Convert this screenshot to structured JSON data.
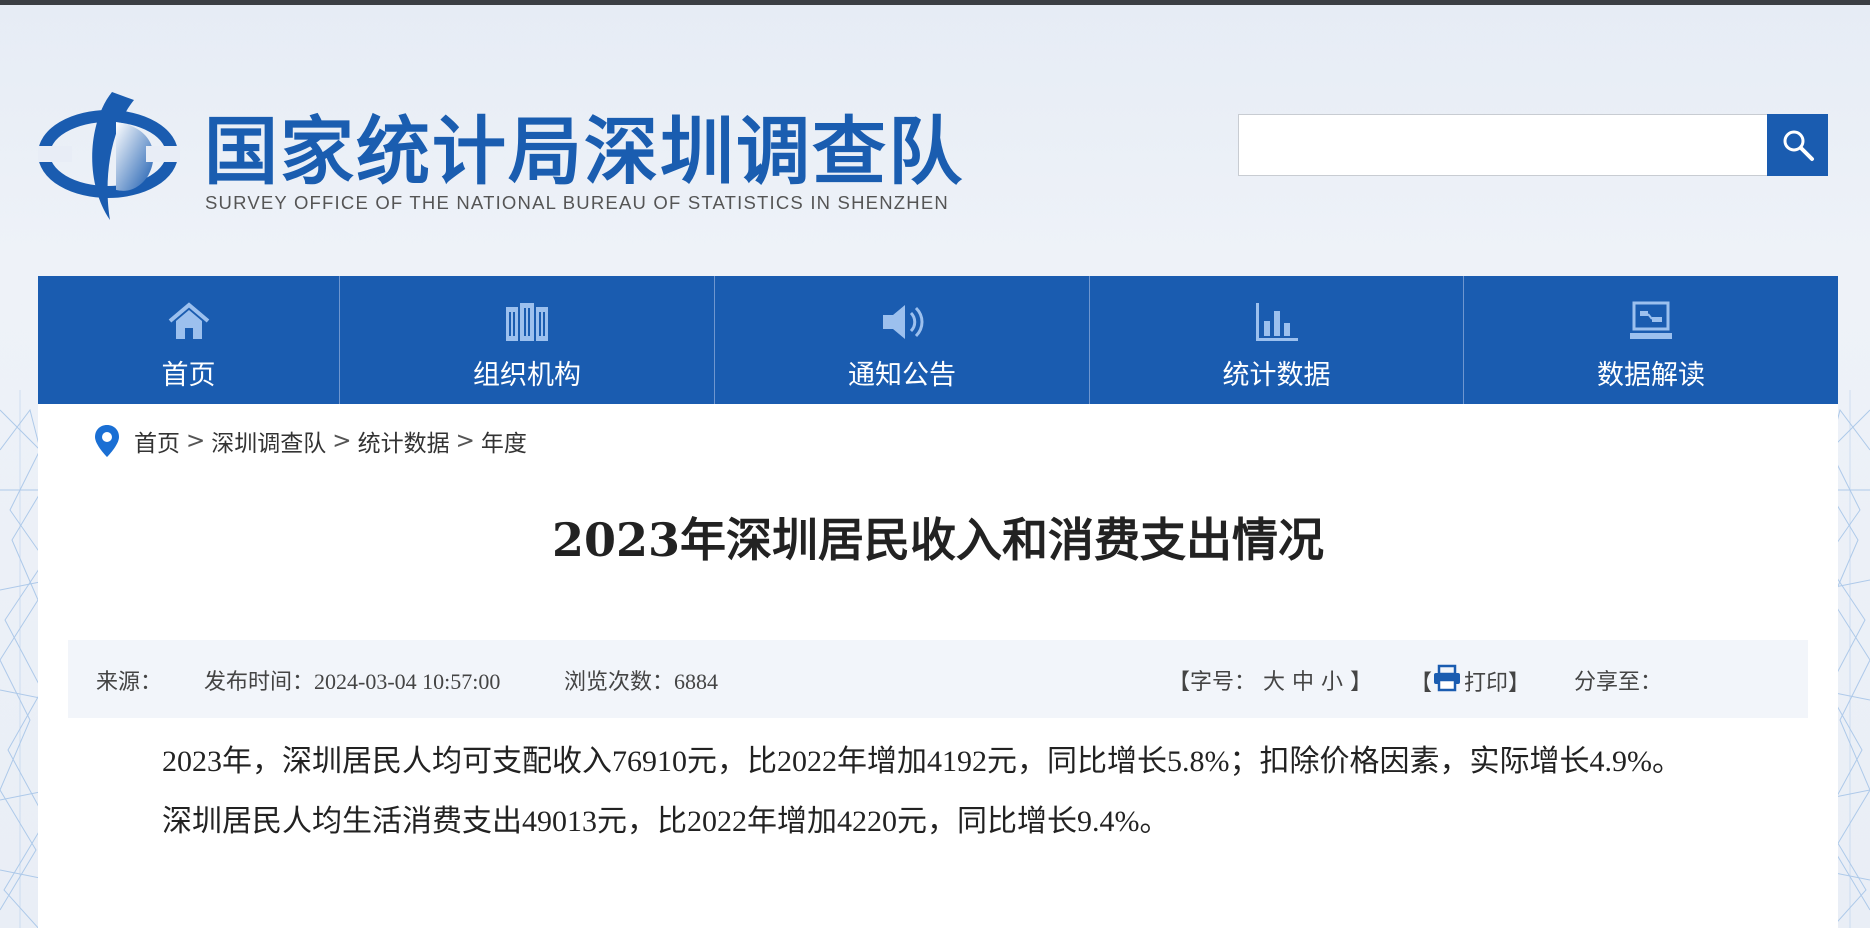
{
  "header": {
    "title": "国家统计局深圳调查队",
    "subtitle": "SURVEY OFFICE OF THE NATIONAL BUREAU OF STATISTICS IN SHENZHEN"
  },
  "search": {
    "value": "",
    "placeholder": ""
  },
  "nav": {
    "items": [
      {
        "label": "首页",
        "icon": "home-icon"
      },
      {
        "label": "组织机构",
        "icon": "building-icon"
      },
      {
        "label": "通知公告",
        "icon": "speaker-icon"
      },
      {
        "label": "统计数据",
        "icon": "bar-chart-icon"
      },
      {
        "label": "数据解读",
        "icon": "monitor-icon"
      }
    ]
  },
  "breadcrumb": {
    "items": [
      "首页",
      "深圳调查队",
      "统计数据",
      "年度"
    ],
    "separator": ">"
  },
  "article": {
    "title": "2023年深圳居民收入和消费支出情况",
    "meta": {
      "source_label": "来源：",
      "publish_label": "发布时间：",
      "publish_time": "2024-03-04 10:57:00",
      "views_label": "浏览次数：",
      "views": "6884",
      "font_size_open": "【字号：",
      "font_large": "大",
      "font_medium": "中",
      "font_small": "小",
      "font_size_close": "】",
      "print_open": "【",
      "print_label": "打印",
      "print_close": "】",
      "share_label": "分享至："
    },
    "paragraphs": [
      "2023年，深圳居民人均可支配收入76910元，比2022年增加4192元，同比增长5.8%；扣除价格因素，实际增长4.9%。",
      "深圳居民人均生活消费支出49013元，比2022年增加4220元，同比增长9.4%。"
    ]
  },
  "colors": {
    "brand_blue": "#1a5cb0",
    "top_bar": "#3b3f44",
    "meta_bg": "#f2f5fa"
  }
}
